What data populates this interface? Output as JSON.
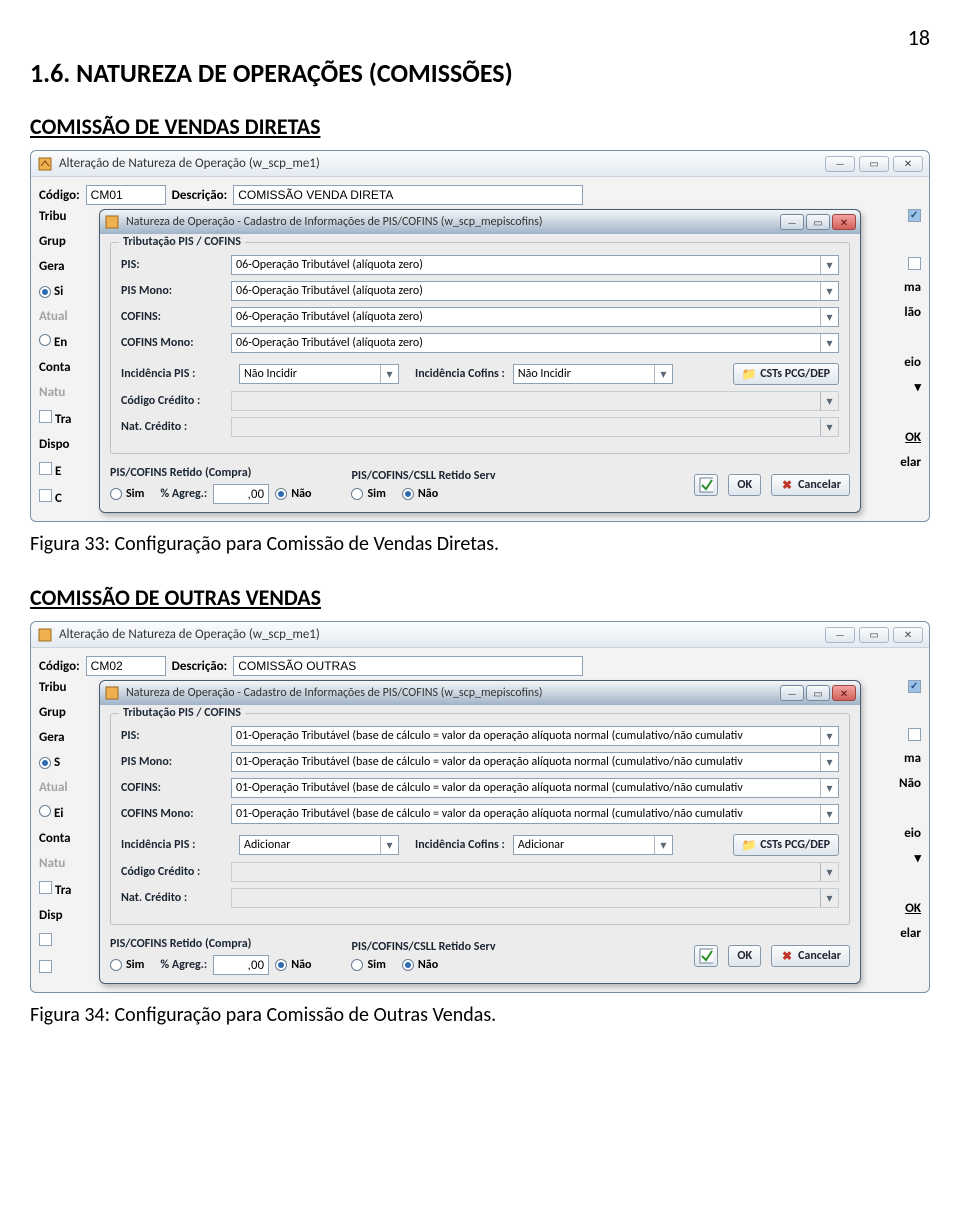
{
  "page_number": "18",
  "section_title": "1.6. NATUREZA DE OPERAÇÕES (COMISSÕES)",
  "block1": {
    "subtitle": "COMISSÃO DE VENDAS DIRETAS",
    "caption": "Figura 33: Configuração para Comissão de Vendas Diretas.",
    "outer": {
      "title": "Alteração de Natureza de Operação (w_scp_me1)",
      "codigo_lbl": "Código:",
      "codigo_val": "CM01",
      "descricao_lbl": "Descrição:",
      "descricao_val": "COMISSÃO VENDA DIRETA",
      "left_labels": [
        "Tribu",
        "Grup",
        "Gera",
        "Atual",
        "Conta",
        "Natu",
        "Dispo"
      ],
      "left_sub": [
        "Si",
        "En",
        "Tra"
      ],
      "left_checks": [
        "E",
        "C"
      ],
      "right_labels": [
        "ma",
        "lão",
        "eio",
        "elar"
      ],
      "ok_btn": "OK"
    },
    "inner": {
      "title": "Natureza de Operação - Cadastro de Informações de PIS/COFINS (w_scp_mepiscofins)",
      "group_legend": "Tributação PIS / COFINS",
      "pis_lbl": "PIS:",
      "pis_val": "06-Operação Tributável (alíquota zero)",
      "pis_mono_lbl": "PIS Mono:",
      "pis_mono_val": "06-Operação Tributável (alíquota zero)",
      "cofins_lbl": "COFINS:",
      "cofins_val": "06-Operação Tributável (alíquota zero)",
      "cofins_mono_lbl": "COFINS Mono:",
      "cofins_mono_val": "06-Operação Tributável (alíquota zero)",
      "inc_pis_lbl": "Incidência PIS :",
      "inc_pis_val": "Não Incidir",
      "inc_cofins_lbl": "Incidência Cofins :",
      "inc_cofins_val": "Não Incidir",
      "csts_btn": "CSTs PCG/DEP",
      "cod_cred_lbl": "Código Crédito :",
      "nat_cred_lbl": "Nat. Crédito :",
      "retido_compra_title": "PIS/COFINS Retido (Compra)",
      "sim": "Sim",
      "nao": "Não",
      "agreg_lbl": "% Agreg.:",
      "agreg_val": ",00",
      "retido_serv_title": "PIS/COFINS/CSLL Retido Serv",
      "ok": "OK",
      "cancelar": "Cancelar"
    }
  },
  "block2": {
    "subtitle": "COMISSÃO DE OUTRAS VENDAS",
    "caption": "Figura 34: Configuração para Comissão de Outras Vendas.",
    "outer": {
      "title": "Alteração de Natureza de Operação (w_scp_me1)",
      "codigo_lbl": "Código:",
      "codigo_val": "CM02",
      "descricao_lbl": "Descrição:",
      "descricao_val": "COMISSÃO OUTRAS",
      "left_labels": [
        "Tribu",
        "Grup",
        "Gera",
        "Atual",
        "Conta",
        "Natu",
        "Disp"
      ],
      "left_sub": [
        "S",
        "Ei",
        "Tra"
      ],
      "right_labels": [
        "ma",
        "Não",
        "eio",
        "elar"
      ],
      "ok_btn": "OK"
    },
    "inner": {
      "title": "Natureza de Operação - Cadastro de Informações de PIS/COFINS (w_scp_mepiscofins)",
      "group_legend": "Tributação PIS / COFINS",
      "pis_lbl": "PIS:",
      "pis_val": "01-Operação Tributável (base de cálculo = valor da operação alíquota normal (cumulativo/não cumulativ",
      "pis_mono_lbl": "PIS Mono:",
      "pis_mono_val": "01-Operação Tributável (base de cálculo = valor da operação alíquota normal (cumulativo/não cumulativ",
      "cofins_lbl": "COFINS:",
      "cofins_val": "01-Operação Tributável (base de cálculo = valor da operação alíquota normal (cumulativo/não cumulativ",
      "cofins_mono_lbl": "COFINS Mono:",
      "cofins_mono_val": "01-Operação Tributável (base de cálculo = valor da operação alíquota normal (cumulativo/não cumulativ",
      "inc_pis_lbl": "Incidência PIS :",
      "inc_pis_val": "Adicionar",
      "inc_cofins_lbl": "Incidência Cofins :",
      "inc_cofins_val": "Adicionar",
      "csts_btn": "CSTs PCG/DEP",
      "cod_cred_lbl": "Código Crédito :",
      "nat_cred_lbl": "Nat. Crédito :",
      "retido_compra_title": "PIS/COFINS Retido (Compra)",
      "sim": "Sim",
      "nao": "Não",
      "agreg_lbl": "% Agreg.:",
      "agreg_val": ",00",
      "retido_serv_title": "PIS/COFINS/CSLL Retido Serv",
      "ok": "OK",
      "cancelar": "Cancelar"
    }
  }
}
